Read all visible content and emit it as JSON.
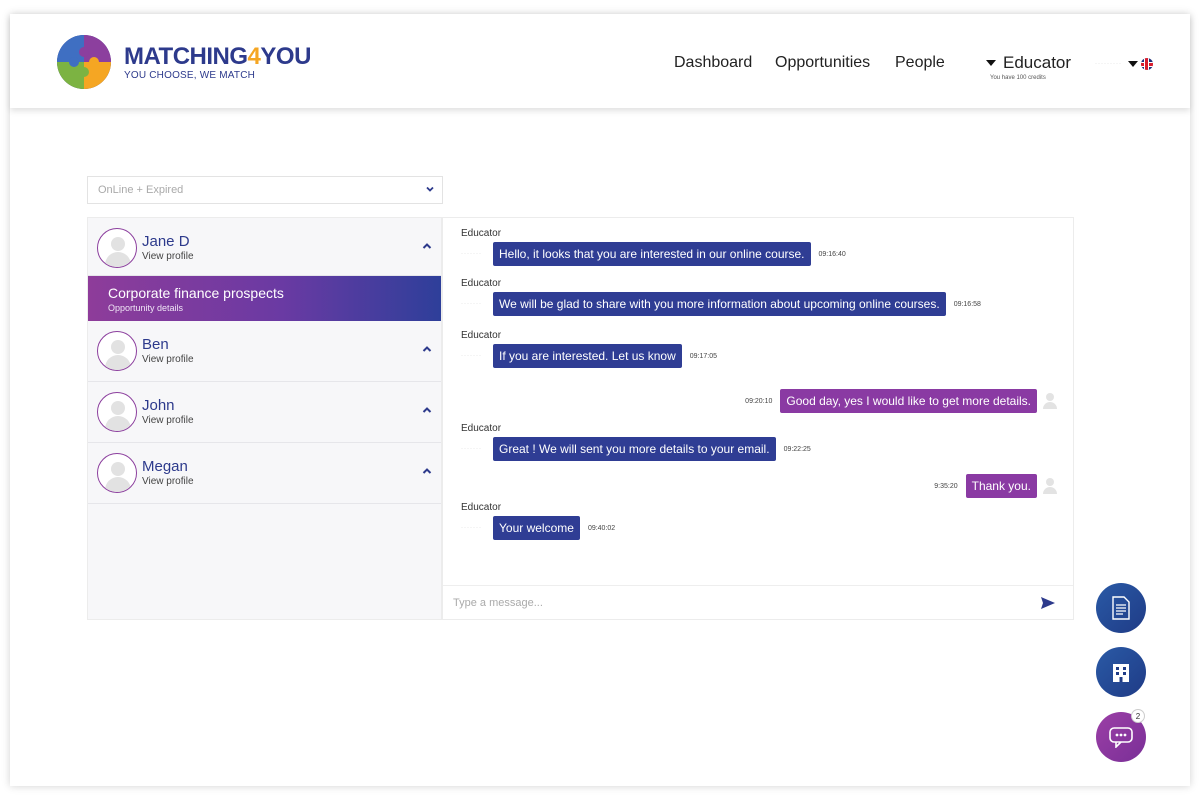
{
  "header": {
    "brand": {
      "name_part1": "MATCHING",
      "name_four": "4",
      "name_part2": "YOU",
      "tagline": "YOU CHOOSE, WE MATCH"
    },
    "nav": {
      "dashboard": "Dashboard",
      "opportunities": "Opportunities",
      "people": "People"
    },
    "role": {
      "label": "Educator",
      "credits": "You have 100 credits"
    },
    "language": {
      "dots": "·········",
      "icon": "uk-flag-icon"
    }
  },
  "filter": {
    "selected": "OnLine + Expired"
  },
  "contacts": [
    {
      "name": "Jane D",
      "link": "View profile",
      "expanded": true
    },
    {
      "name": "Ben",
      "link": "View profile"
    },
    {
      "name": "John",
      "link": "View profile"
    },
    {
      "name": "Megan",
      "link": "View profile"
    }
  ],
  "opportunity": {
    "title": "Corporate finance prospects",
    "link": "Opportunity details"
  },
  "messages": [
    {
      "sender": "Educator",
      "text": "Hello, it looks that you are interested in our online course.",
      "time": "09:16:40",
      "dir": "in"
    },
    {
      "sender": "Educator",
      "text": "We will be glad to share with you more information about upcoming online courses.",
      "time": "09:16:58",
      "dir": "in"
    },
    {
      "sender": "Educator",
      "text": "If you are interested. Let us know",
      "time": "09:17:05",
      "dir": "in"
    },
    {
      "sender": "",
      "text": "Good day, yes I would like to get more details.",
      "time": "09:20:10",
      "dir": "out"
    },
    {
      "sender": "Educator",
      "text": "Great ! We will sent you more details to your email.",
      "time": "09:22:25",
      "dir": "in"
    },
    {
      "sender": "",
      "text": "Thank you.",
      "time": "9:35:20",
      "dir": "out"
    },
    {
      "sender": "Educator",
      "text": "Your welcome",
      "time": "09:40:02",
      "dir": "in"
    }
  ],
  "composer": {
    "placeholder": "Type a message..."
  },
  "fabs": {
    "chat_badge": "2"
  },
  "colors": {
    "brand_blue": "#2d3a8c",
    "bubble_in": "#2f3d94",
    "bubble_out": "#8a3aa3",
    "accent_orange": "#f5a623"
  }
}
